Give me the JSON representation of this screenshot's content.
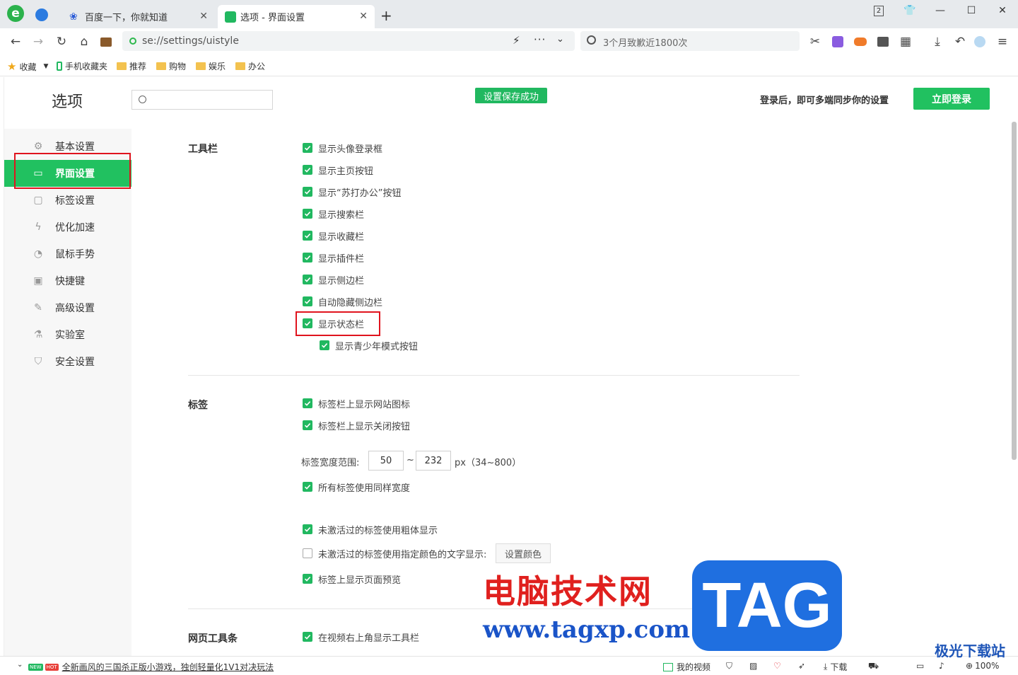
{
  "tabs": [
    {
      "title": "百度一下，你就知道",
      "active": false
    },
    {
      "title": "选项 - 界面设置",
      "active": true
    }
  ],
  "window_badge": "2",
  "address": {
    "url": "se://settings/uistyle"
  },
  "search": {
    "placeholder": "3个月致歉近1800次"
  },
  "bookmarks": {
    "star_label": "收藏",
    "items": [
      "手机收藏夹",
      "推荐",
      "购物",
      "娱乐",
      "办公"
    ]
  },
  "header": {
    "title": "选项",
    "saved_toast": "设置保存成功",
    "login_tip": "登录后，即可多端同步你的设置",
    "login_button": "立即登录"
  },
  "sidebar": {
    "items": [
      {
        "label": "基本设置",
        "icon": "gear-icon"
      },
      {
        "label": "界面设置",
        "icon": "window-icon",
        "active": true
      },
      {
        "label": "标签设置",
        "icon": "tab-icon"
      },
      {
        "label": "优化加速",
        "icon": "lightning-icon"
      },
      {
        "label": "鼠标手势",
        "icon": "mouse-icon"
      },
      {
        "label": "快捷键",
        "icon": "keyboard-icon"
      },
      {
        "label": "高级设置",
        "icon": "wrench-icon"
      },
      {
        "label": "实验室",
        "icon": "flask-icon"
      },
      {
        "label": "安全设置",
        "icon": "shield-icon"
      }
    ]
  },
  "toolbar_section": {
    "title": "工具栏",
    "options": [
      {
        "label": "显示头像登录框",
        "checked": true
      },
      {
        "label": "显示主页按钮",
        "checked": true
      },
      {
        "label": "显示“苏打办公”按钮",
        "checked": true
      },
      {
        "label": "显示搜索栏",
        "checked": true
      },
      {
        "label": "显示收藏栏",
        "checked": true
      },
      {
        "label": "显示插件栏",
        "checked": true
      },
      {
        "label": "显示侧边栏",
        "checked": true
      },
      {
        "label": "自动隐藏侧边栏",
        "checked": true
      },
      {
        "label": "显示状态栏",
        "checked": true
      },
      {
        "label": "显示青少年模式按钮",
        "checked": true
      }
    ]
  },
  "tabs_section": {
    "title": "标签",
    "options": [
      {
        "label": "标签栏上显示网站图标",
        "checked": true
      },
      {
        "label": "标签栏上显示关闭按钮",
        "checked": true
      }
    ],
    "width_label": "标签宽度范围:",
    "width_min": "50",
    "width_sep": "~",
    "width_max": "232",
    "width_unit": "px（34~800）",
    "same_width": {
      "label": "所有标签使用同样宽度",
      "checked": true
    },
    "bold_inactive": {
      "label": "未激活过的标签使用粗体显示",
      "checked": true
    },
    "color_inactive": {
      "label": "未激活过的标签使用指定颜色的文字显示:",
      "checked": false
    },
    "color_button": "设置颜色",
    "preview": {
      "label": "标签上显示页面预览",
      "checked": true
    }
  },
  "webtools_section": {
    "title": "网页工具条",
    "options": [
      {
        "label": "在视频右上角显示工具栏",
        "checked": true
      }
    ]
  },
  "statusbar": {
    "new_badge": "NEW",
    "hot_badge": "HOT",
    "news": "全新画风的三国杀正版小游戏，独创轻量化1V1对决玩法",
    "my_video": "我的视频",
    "download": "下载",
    "zoom": "100%"
  },
  "watermark": {
    "cn": "电脑技术网",
    "url": "www.tagxp.com",
    "tag": "TAG",
    "site": "极光下载站"
  },
  "colors": {
    "accent": "#21c160",
    "highlight": "#e0141e"
  }
}
